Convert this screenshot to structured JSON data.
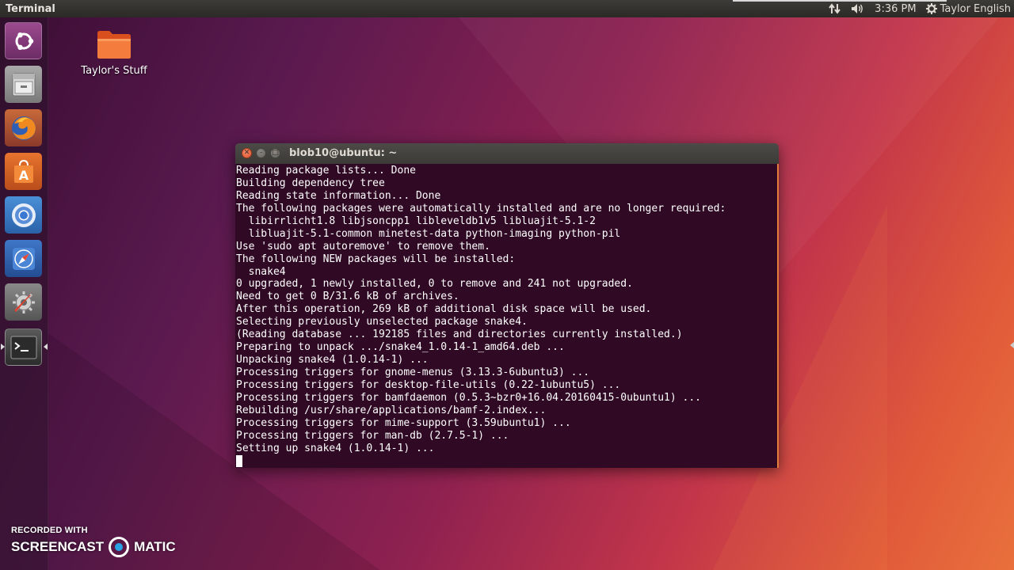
{
  "top_panel": {
    "app_title": "Terminal",
    "time": "3:36 PM",
    "user": "Taylor English",
    "network_icon": "network-updown-icon",
    "sound_icon": "volume-icon",
    "session_icon": "gear-icon"
  },
  "launcher": {
    "items": [
      {
        "name": "dash",
        "icon": "ubuntu-logo-icon"
      },
      {
        "name": "files",
        "icon": "file-cabinet-icon"
      },
      {
        "name": "firefox",
        "icon": "firefox-icon"
      },
      {
        "name": "ubuntu-software",
        "icon": "shopping-bag-icon"
      },
      {
        "name": "chromium",
        "icon": "chromium-icon"
      },
      {
        "name": "web-browser",
        "icon": "compass-icon"
      },
      {
        "name": "system-settings",
        "icon": "wrench-gear-icon"
      },
      {
        "name": "terminal",
        "icon": "terminal-icon"
      }
    ]
  },
  "desktop": {
    "folder_label": "Taylor's Stuff"
  },
  "terminal": {
    "title": "blob10@ubuntu: ~",
    "lines": [
      "Reading package lists... Done",
      "Building dependency tree",
      "Reading state information... Done",
      "The following packages were automatically installed and are no longer required:",
      "  libirrlicht1.8 libjsoncpp1 libleveldb1v5 libluajit-5.1-2",
      "  libluajit-5.1-common minetest-data python-imaging python-pil",
      "Use 'sudo apt autoremove' to remove them.",
      "The following NEW packages will be installed:",
      "  snake4",
      "0 upgraded, 1 newly installed, 0 to remove and 241 not upgraded.",
      "Need to get 0 B/31.6 kB of archives.",
      "After this operation, 269 kB of additional disk space will be used.",
      "Selecting previously unselected package snake4.",
      "(Reading database ... 192185 files and directories currently installed.)",
      "Preparing to unpack .../snake4_1.0.14-1_amd64.deb ...",
      "Unpacking snake4 (1.0.14-1) ...",
      "Processing triggers for gnome-menus (3.13.3-6ubuntu3) ...",
      "Processing triggers for desktop-file-utils (0.22-1ubuntu5) ...",
      "Processing triggers for bamfdaemon (0.5.3~bzr0+16.04.20160415-0ubuntu1) ...",
      "Rebuilding /usr/share/applications/bamf-2.index...",
      "Processing triggers for mime-support (3.59ubuntu1) ...",
      "Processing triggers for man-db (2.7.5-1) ...",
      "Setting up snake4 (1.0.14-1) ..."
    ]
  },
  "watermark": {
    "line1": "RECORDED WITH",
    "left": "SCREENCAST",
    "right": "MATIC"
  },
  "colors": {
    "terminal_bg": "#300a24",
    "terminal_fg": "#ffffff",
    "panel_bg": "#3c3b37",
    "close_button": "#e0532b",
    "accent": "#e37c3a"
  }
}
